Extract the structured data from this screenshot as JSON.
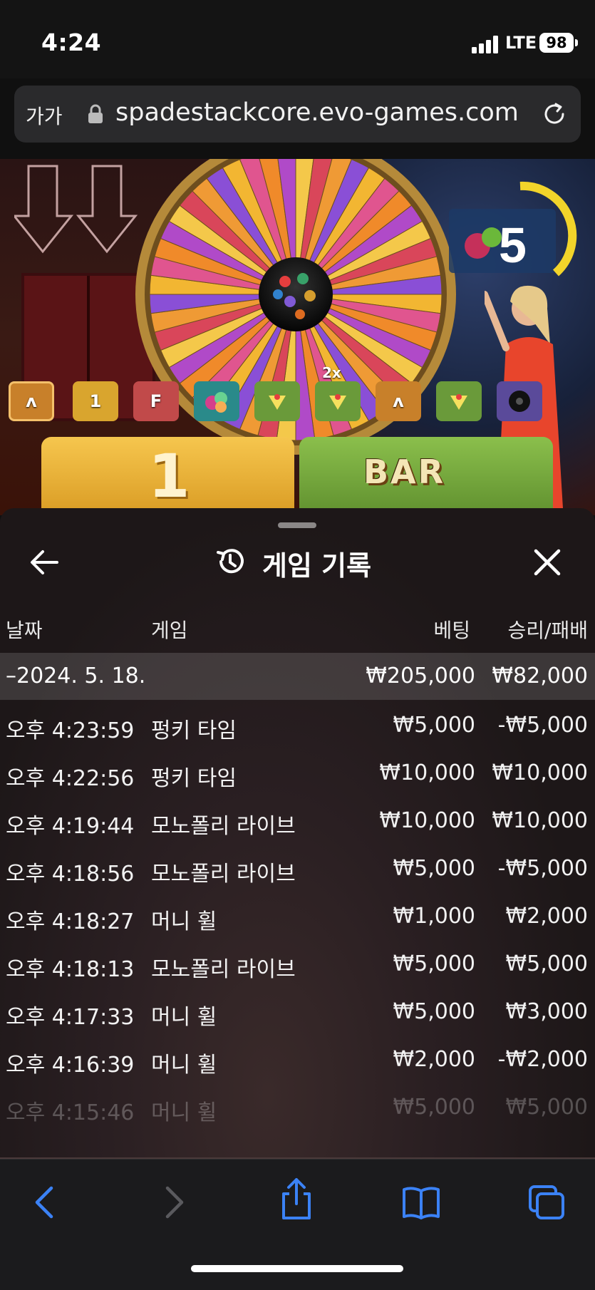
{
  "status_bar": {
    "time": "4:24",
    "network": "LTE",
    "battery": "98"
  },
  "browser": {
    "text_size_label": "가가",
    "url": "spadestackcore.evo-games.com"
  },
  "game_view": {
    "countdown": "5",
    "tiles": [
      "ʌ",
      "1",
      "F",
      "",
      "",
      "",
      "ʌ",
      "",
      ""
    ],
    "multiplier_tag": "2x",
    "bet_spots": [
      {
        "label": "1"
      },
      {
        "label": "BAR"
      }
    ]
  },
  "history_panel": {
    "title": "게임 기록",
    "columns": {
      "date": "날짜",
      "game": "게임",
      "bet": "베팅",
      "result": "승리/패배"
    },
    "day_group": {
      "date": "–2024. 5. 18.",
      "bet": "₩205,000",
      "result": "₩82,000"
    },
    "rows": [
      {
        "time": "오후 4:23:59",
        "game": "펑키 타임",
        "bet": "₩5,000",
        "result": "-₩5,000"
      },
      {
        "time": "오후 4:22:56",
        "game": "펑키 타임",
        "bet": "₩10,000",
        "result": "₩10,000"
      },
      {
        "time": "오후 4:19:44",
        "game": "모노폴리 라이브",
        "bet": "₩10,000",
        "result": "₩10,000"
      },
      {
        "time": "오후 4:18:56",
        "game": "모노폴리 라이브",
        "bet": "₩5,000",
        "result": "-₩5,000"
      },
      {
        "time": "오후 4:18:27",
        "game": "머니 휠",
        "bet": "₩1,000",
        "result": "₩2,000"
      },
      {
        "time": "오후 4:18:13",
        "game": "모노폴리 라이브",
        "bet": "₩5,000",
        "result": "₩5,000"
      },
      {
        "time": "오후 4:17:33",
        "game": "머니 휠",
        "bet": "₩5,000",
        "result": "₩3,000"
      },
      {
        "time": "오후 4:16:39",
        "game": "머니 휠",
        "bet": "₩2,000",
        "result": "-₩2,000"
      },
      {
        "time": "오후 4:15:46",
        "game": "머니 휠",
        "bet": "₩5,000",
        "result": "₩5,000"
      }
    ]
  },
  "toolbar": {
    "icons": [
      "back-icon",
      "forward-icon",
      "share-icon",
      "bookmarks-icon",
      "tabs-icon"
    ],
    "accent": "#3b82f6"
  }
}
